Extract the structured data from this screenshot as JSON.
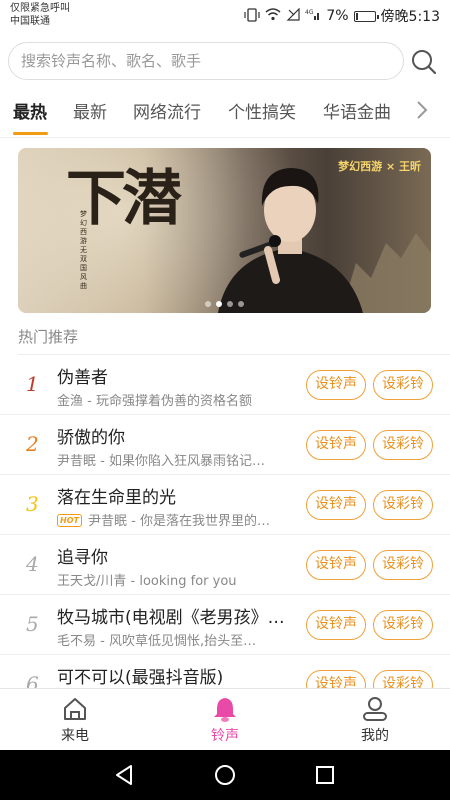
{
  "status_bar": {
    "carrier_line1": "仅限紧急呼叫",
    "carrier_line2": "中国联通",
    "battery": "7%",
    "time": "傍晚5:13"
  },
  "search": {
    "placeholder": "搜索铃声名称、歌名、歌手"
  },
  "tabs": [
    "最热",
    "最新",
    "网络流行",
    "个性搞笑",
    "华语金曲"
  ],
  "banner": {
    "title": "下潜",
    "subtitle_vertical": "梦幻西游无双国风曲",
    "logo": "梦幻西游 × 王昕",
    "slide_count": 4,
    "active_slide": 2
  },
  "section_title": "热门推荐",
  "buttons": {
    "set_ringtone": "设铃声",
    "set_color_ring": "设彩铃"
  },
  "songs": [
    {
      "rank": "1",
      "name": "伪善者",
      "hot": "",
      "artist": "金渔",
      "desc": "玩命强撑着伪善的资格名额"
    },
    {
      "rank": "2",
      "name": "骄傲的你",
      "hot": "",
      "artist": "尹昔眠",
      "desc": "如果你陷入狂风暴雨铭记…"
    },
    {
      "rank": "3",
      "name": "落在生命里的光",
      "hot": "HOT",
      "artist": "尹昔眠",
      "desc": "你是落在我世界里的…"
    },
    {
      "rank": "4",
      "name": "追寻你",
      "hot": "",
      "artist": "王天戈/川青",
      "desc": "looking for you"
    },
    {
      "rank": "5",
      "name": "牧马城市(电视剧《老男孩》…",
      "hot": "",
      "artist": "毛不易",
      "desc": "风吹草低见惆怅,抬头至…"
    },
    {
      "rank": "6",
      "name": "可不可以(最强抖音版)",
      "hot": "",
      "artist": "",
      "desc": ""
    }
  ],
  "rank_colors": [
    "#c0392b",
    "#e67e22",
    "#f1c40f",
    "#aaaaaa",
    "#aaaaaa",
    "#aaaaaa"
  ],
  "bottom_nav": [
    {
      "label": "来电",
      "icon": "home-icon"
    },
    {
      "label": "铃声",
      "icon": "bell-icon",
      "active": true
    },
    {
      "label": "我的",
      "icon": "user-icon"
    }
  ],
  "accent_color": "#f0a13a",
  "active_nav_color": "#e94aa8"
}
